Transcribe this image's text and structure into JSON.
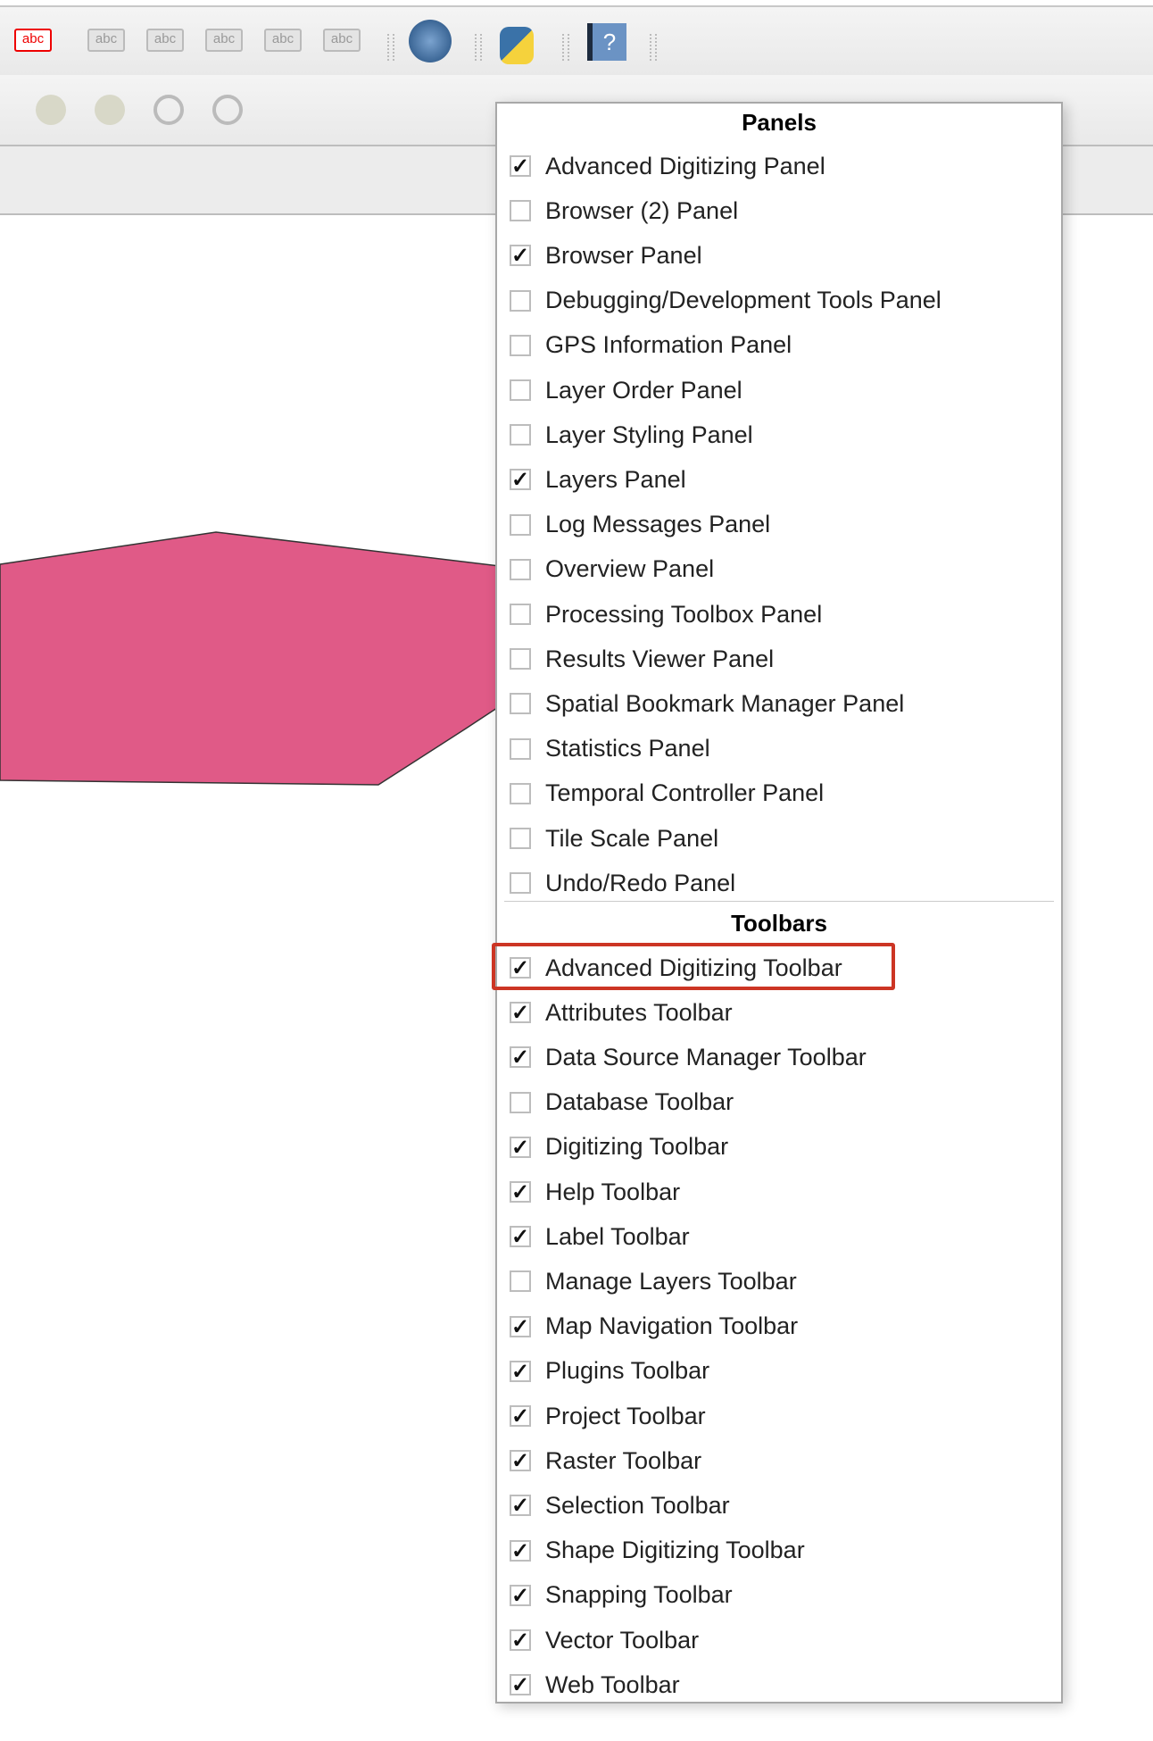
{
  "toolbar_icons": [
    "label-red-icon",
    "pin-label-icon",
    "show-hide-label-icon",
    "move-label-icon",
    "rotate-label-icon",
    "change-label-icon",
    "metasearch-icon",
    "python-console-icon",
    "help-icon"
  ],
  "toolbar2_icons": [
    "move-diagram-icon",
    "pin-diagram-icon",
    "show-diagram-icon",
    "pin-annotation-icon",
    "show-annotation-icon"
  ],
  "menu": {
    "panels_header": "Panels",
    "panels": [
      {
        "label": "Advanced Digitizing Panel",
        "checked": true
      },
      {
        "label": "Browser (2) Panel",
        "checked": false
      },
      {
        "label": "Browser Panel",
        "checked": true
      },
      {
        "label": "Debugging/Development Tools Panel",
        "checked": false
      },
      {
        "label": "GPS Information Panel",
        "checked": false
      },
      {
        "label": "Layer Order Panel",
        "checked": false
      },
      {
        "label": "Layer Styling Panel",
        "checked": false
      },
      {
        "label": "Layers Panel",
        "checked": true
      },
      {
        "label": "Log Messages Panel",
        "checked": false
      },
      {
        "label": "Overview Panel",
        "checked": false
      },
      {
        "label": "Processing Toolbox Panel",
        "checked": false
      },
      {
        "label": "Results Viewer Panel",
        "checked": false
      },
      {
        "label": "Spatial Bookmark Manager Panel",
        "checked": false
      },
      {
        "label": "Statistics Panel",
        "checked": false
      },
      {
        "label": "Temporal Controller Panel",
        "checked": false
      },
      {
        "label": "Tile Scale Panel",
        "checked": false
      },
      {
        "label": "Undo/Redo Panel",
        "checked": false
      }
    ],
    "toolbars_header": "Toolbars",
    "toolbars": [
      {
        "label": "Advanced Digitizing Toolbar",
        "checked": true,
        "highlighted": true
      },
      {
        "label": "Attributes Toolbar",
        "checked": true
      },
      {
        "label": "Data Source Manager Toolbar",
        "checked": true
      },
      {
        "label": "Database Toolbar",
        "checked": false
      },
      {
        "label": "Digitizing Toolbar",
        "checked": true
      },
      {
        "label": "Help Toolbar",
        "checked": true
      },
      {
        "label": "Label Toolbar",
        "checked": true
      },
      {
        "label": "Manage Layers Toolbar",
        "checked": false
      },
      {
        "label": "Map Navigation Toolbar",
        "checked": true
      },
      {
        "label": "Plugins Toolbar",
        "checked": true
      },
      {
        "label": "Project Toolbar",
        "checked": true
      },
      {
        "label": "Raster Toolbar",
        "checked": true
      },
      {
        "label": "Selection Toolbar",
        "checked": true
      },
      {
        "label": "Shape Digitizing Toolbar",
        "checked": true
      },
      {
        "label": "Snapping Toolbar",
        "checked": true
      },
      {
        "label": "Vector Toolbar",
        "checked": true
      },
      {
        "label": "Web Toolbar",
        "checked": true
      }
    ]
  },
  "colors": {
    "polygon": "#e05a87",
    "highlight": "#cc3524"
  },
  "check_mark": "✓",
  "icon_text": {
    "abc": "abc",
    "help": "?"
  }
}
